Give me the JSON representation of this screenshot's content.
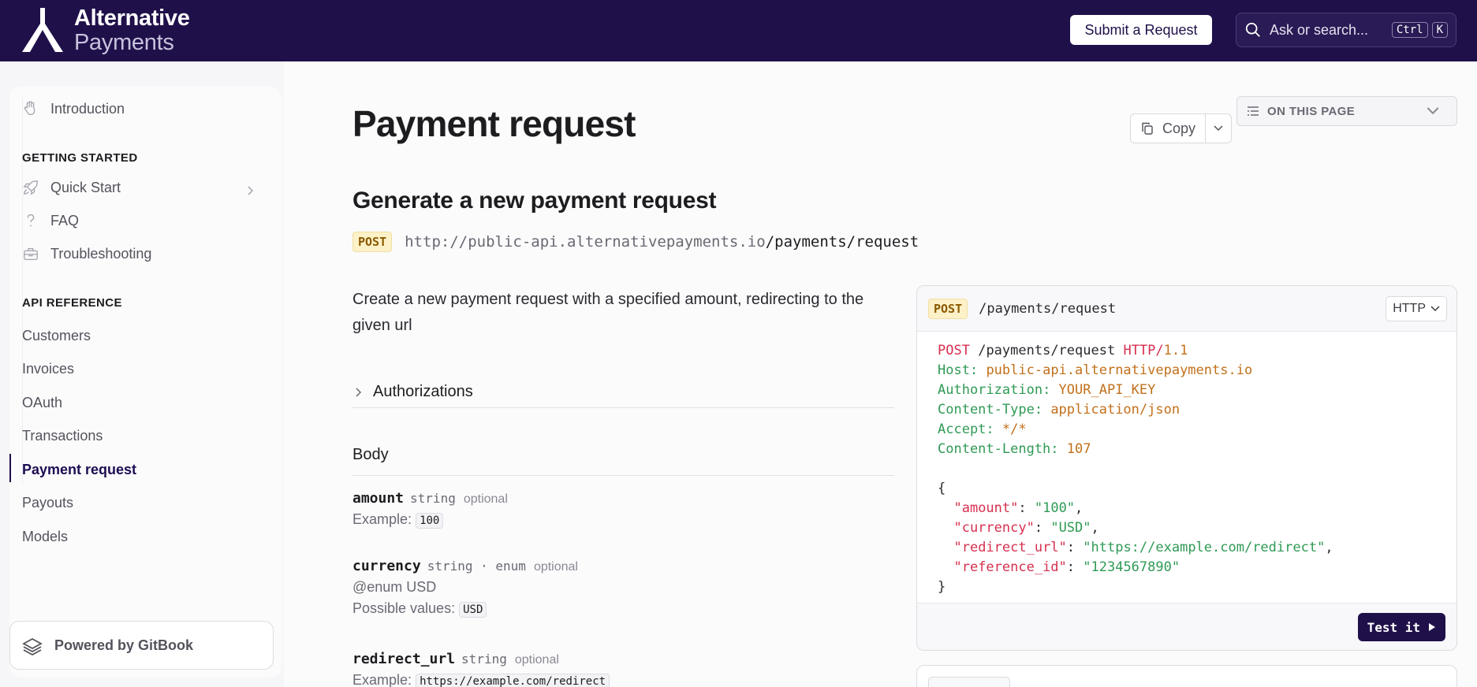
{
  "header": {
    "brand_line1": "Alternative",
    "brand_line2": "Payments",
    "submit_label": "Submit a Request",
    "search_placeholder": "Ask or search...",
    "kbd_ctrl": "Ctrl",
    "kbd_k": "K"
  },
  "sidebar": {
    "intro": "Introduction",
    "section_getting_started": "GETTING STARTED",
    "quick_start": "Quick Start",
    "faq": "FAQ",
    "troubleshooting": "Troubleshooting",
    "section_api": "API REFERENCE",
    "api_items": [
      "Customers",
      "Invoices",
      "OAuth",
      "Transactions",
      "Payment request",
      "Payouts",
      "Models"
    ],
    "powered": "Powered by GitBook"
  },
  "page": {
    "title": "Payment request",
    "copy_label": "Copy",
    "on_this_page": "ON THIS PAGE",
    "subtitle": "Generate a new payment request",
    "method": "POST",
    "host": "http://public-api.alternativepayments.io",
    "path": "/payments/request",
    "description": "Create a new payment request with a specified amount, redirecting to the given url",
    "authorizations": "Authorizations",
    "body_heading": "Body",
    "fields": {
      "amount": {
        "name": "amount",
        "type": "string",
        "optional": "optional",
        "example_label": "Example:",
        "example": "100"
      },
      "currency": {
        "name": "currency",
        "type": "string · enum",
        "optional": "optional",
        "enum_note": "@enum USD",
        "possible_label": "Possible values:",
        "possible": "USD"
      },
      "redirect_url": {
        "name": "redirect_url",
        "type": "string",
        "optional": "optional",
        "example_label": "Example:",
        "example": "https://example.com/redirect"
      }
    }
  },
  "code_panel": {
    "method": "POST",
    "path": "/payments/request",
    "lang": "HTTP",
    "request_path": "/payments/request",
    "http_proto": "HTTP/",
    "http_ver": "1.1",
    "host_key": "Host",
    "host_val": "public-api.alternativepayments.io",
    "auth_key": "Authorization",
    "auth_val": "YOUR_API_KEY",
    "ctype_key": "Content-Type",
    "ctype_val": "application/json",
    "accept_key": "Accept",
    "accept_val": "*/*",
    "clen_key": "Content-Length",
    "clen_val": "107",
    "json_amount_key": "\"amount\"",
    "json_amount_val": "\"100\"",
    "json_currency_key": "\"currency\"",
    "json_currency_val": "\"USD\"",
    "json_redirect_key": "\"redirect_url\"",
    "json_redirect_val": "\"https://example.com/redirect\"",
    "json_ref_key": "\"reference_id\"",
    "json_ref_val": "\"1234567890\"",
    "test_label": "Test it"
  },
  "colors": {
    "brand": "#20104a",
    "post_badge_bg": "#fdf1c8",
    "post_badge_text": "#8a5a00"
  }
}
